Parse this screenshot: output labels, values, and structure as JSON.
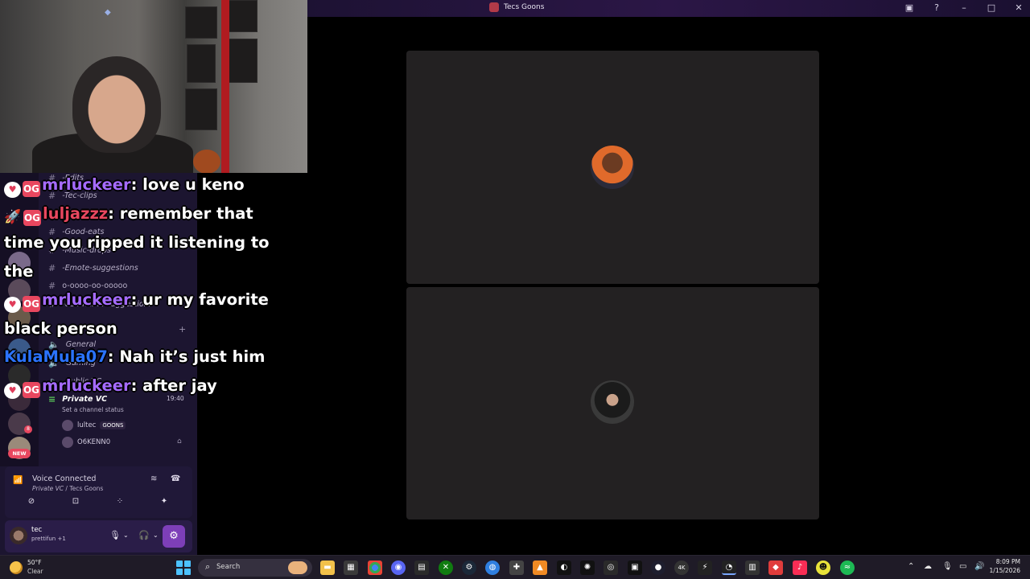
{
  "window": {
    "title": "Tecs Goons",
    "controls": [
      "screen-share-icon",
      "help-icon",
      "minimize-icon",
      "maximize-icon",
      "close-icon"
    ]
  },
  "sidebar": {
    "channels": [
      {
        "label": "-Edits",
        "icon": "hash-icon"
      },
      {
        "label": "-Tec-clips",
        "icon": "hash-icon"
      },
      {
        "label": "-Good-eats",
        "icon": "hash-icon"
      },
      {
        "label": "-Music-drops",
        "icon": "hash-icon"
      },
      {
        "label": "-Emote-suggestions",
        "icon": "hash-icon"
      },
      {
        "label": "o-oooo-oo-ooooo",
        "icon": "hash-icon"
      },
      {
        "label": "-Username-suggestions",
        "icon": "hash-icon"
      }
    ],
    "voice_channels": [
      {
        "label": "General",
        "icon": "speaker-icon"
      },
      {
        "label": "Gaming",
        "icon": "speaker-icon"
      },
      {
        "label": "Public VC",
        "icon": "speaker-icon"
      },
      {
        "label": "Private VC",
        "icon": "speaker-icon"
      }
    ],
    "private_vc_time": "19:40",
    "channel_status": "Set a channel status",
    "members": [
      {
        "name": "lultec",
        "tag": "GOONS"
      },
      {
        "name": "O6KENN0",
        "tag": ""
      }
    ],
    "server_badge": "NEW",
    "server_count": "8"
  },
  "voice": {
    "title": "Voice Connected",
    "channel": "Private VC",
    "server": "Tecs Goons"
  },
  "user": {
    "name": "tec",
    "status": "prettifun +1"
  },
  "chat": [
    {
      "badges": [
        "heart",
        "OG"
      ],
      "user": "mrluckeer",
      "color": "#a56bff",
      "message": "love u keno"
    },
    {
      "badges": [
        "rocket",
        "OG"
      ],
      "user": "luljazzz",
      "color": "#e8475f",
      "message": "remember that time you ripped it listening to the"
    },
    {
      "badges": [
        "heart",
        "OG"
      ],
      "user": "mrluckeer",
      "color": "#a56bff",
      "message": "ur my favorite black person"
    },
    {
      "badges": [],
      "user": "KulaMula07",
      "color": "#2b73ff",
      "message": "Nah it’s just him"
    },
    {
      "badges": [
        "heart",
        "OG"
      ],
      "user": "mrluckeer",
      "color": "#a56bff",
      "message": "after jay"
    }
  ],
  "taskbar": {
    "weather_temp": "50°F",
    "weather_cond": "Clear",
    "search_placeholder": "Search",
    "time": "8:09 PM",
    "date": "1/15/2026"
  }
}
